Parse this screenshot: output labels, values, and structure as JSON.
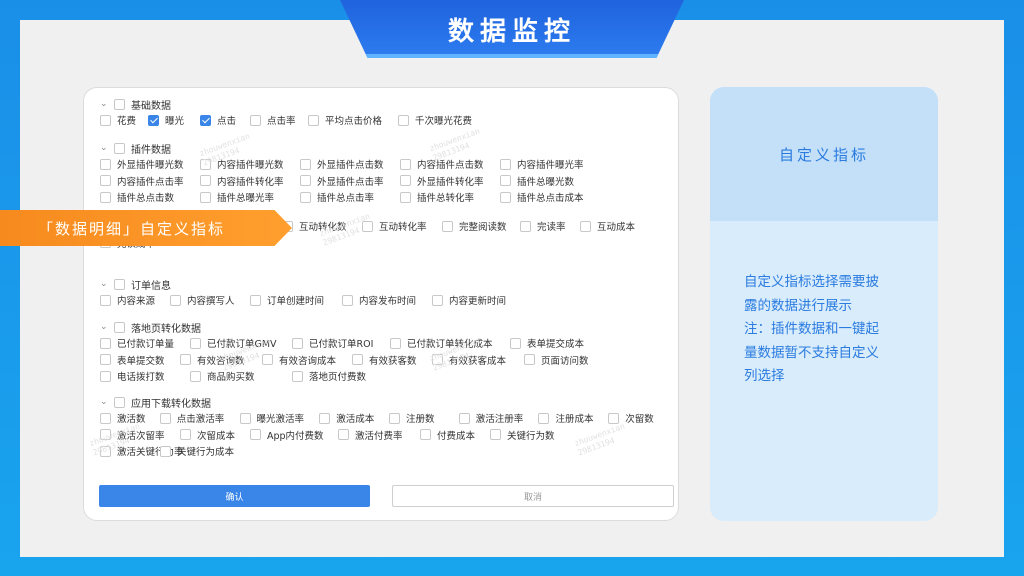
{
  "header": {
    "title": "数据监控"
  },
  "ribbon": {
    "label": "「数据明细」自定义指标"
  },
  "panel": {
    "sections": [
      {
        "name": "基础数据",
        "rows": [
          [
            {
              "label": "花费",
              "checked": false
            },
            {
              "label": "曝光",
              "checked": true
            },
            {
              "label": "点击",
              "checked": true
            },
            {
              "label": "点击率",
              "checked": false
            },
            {
              "label": "平均点击价格",
              "checked": false
            },
            {
              "label": "千次曝光花费",
              "checked": false
            }
          ]
        ]
      },
      {
        "name": "插件数据",
        "rows": [
          [
            {
              "label": "外显插件曝光数"
            },
            {
              "label": "内容插件曝光数"
            },
            {
              "label": "外显插件点击数"
            },
            {
              "label": "内容插件点击数"
            },
            {
              "label": "内容插件曝光率"
            }
          ],
          [
            {
              "label": "内容插件点击率"
            },
            {
              "label": "内容插件转化率"
            },
            {
              "label": "外显插件点击率"
            },
            {
              "label": "外显插件转化率"
            },
            {
              "label": "插件总曝光数"
            }
          ],
          [
            {
              "label": "插件总点击数"
            },
            {
              "label": "插件总曝光率"
            },
            {
              "label": "插件总点击率"
            },
            {
              "label": "插件总转化率"
            },
            {
              "label": "插件总点击成本"
            }
          ]
        ]
      },
      {
        "name": "",
        "rows": [
          [
            {
              "label": "互动转化数"
            },
            {
              "label": "互动转化率"
            },
            {
              "label": "完整阅读数"
            },
            {
              "label": "完读率"
            },
            {
              "label": "互动成本"
            }
          ],
          [
            {
              "label": "完读成本"
            }
          ]
        ]
      },
      {
        "name": "订单信息",
        "rows": [
          [
            {
              "label": "内容来源"
            },
            {
              "label": "内容撰写人"
            },
            {
              "label": "订单创建时间"
            },
            {
              "label": "内容发布时间"
            },
            {
              "label": "内容更新时间"
            }
          ]
        ]
      },
      {
        "name": "落地页转化数据",
        "rows": [
          [
            {
              "label": "已付款订单量"
            },
            {
              "label": "已付款订单GMV"
            },
            {
              "label": "已付款订单ROI"
            },
            {
              "label": "已付款订单转化成本"
            },
            {
              "label": "表单提交成本"
            }
          ],
          [
            {
              "label": "表单提交数"
            },
            {
              "label": "有效咨询数"
            },
            {
              "label": "有效咨询成本"
            },
            {
              "label": "有效获客数"
            },
            {
              "label": "有效获客成本"
            },
            {
              "label": "页面访问数"
            }
          ],
          [
            {
              "label": "电话拨打数"
            },
            {
              "label": "商品购买数"
            },
            {
              "label": "落地页付费数"
            }
          ]
        ]
      },
      {
        "name": "应用下载转化数据",
        "rows": [
          [
            {
              "label": "激活数"
            },
            {
              "label": "点击激活率"
            },
            {
              "label": "曝光激活率"
            },
            {
              "label": "激活成本"
            },
            {
              "label": "注册数"
            },
            {
              "label": "激活注册率"
            },
            {
              "label": "注册成本"
            },
            {
              "label": "次留数"
            }
          ],
          [
            {
              "label": "激活次留率"
            },
            {
              "label": "次留成本"
            },
            {
              "label": "App内付费数"
            },
            {
              "label": "激活付费率"
            },
            {
              "label": "付费成本"
            },
            {
              "label": "关键行为数"
            }
          ],
          [
            {
              "label": "激活关键行为率"
            },
            {
              "label": "关键行为成本"
            }
          ]
        ]
      }
    ],
    "confirm_label": "确认",
    "cancel_label": "取消"
  },
  "side": {
    "title": "自定义指标",
    "body": "自定义指标选择需要披露的数据进行展示\n注：插件数据和一键起量数据暂不支持自定义列选择",
    "lines": [
      "自定义指标选择需要披",
      "露的数据进行展示",
      "注：插件数据和一键起",
      "量数据暂不支持自定义",
      "列选择"
    ]
  },
  "watermark": {
    "name": "zhouwenxian",
    "id": "29813194"
  }
}
